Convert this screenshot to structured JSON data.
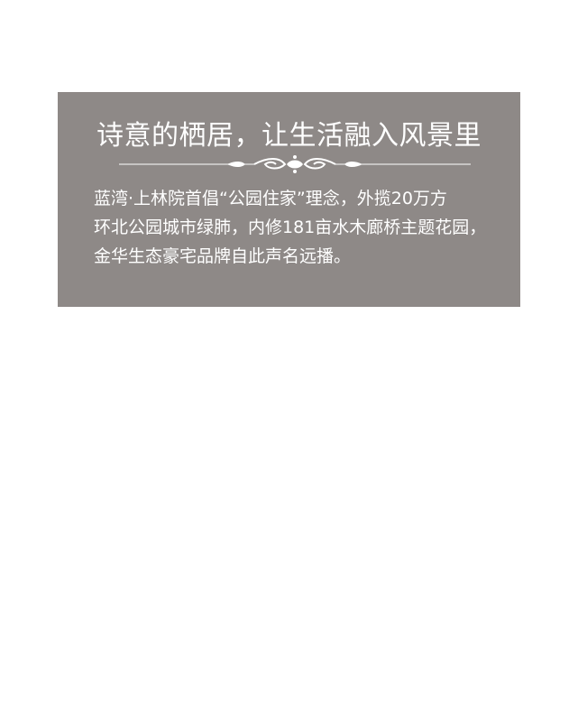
{
  "panel": {
    "title": "诗意的栖居，让生活融入风景里",
    "ornament_icon": "flourish-divider-icon",
    "body_lines": [
      "蓝湾·上林院首倡“公园住家”理念，外揽20万方",
      "环北公园城市绿肺，内修181亩水木廊桥主题花园，",
      "金华生态豪宅品牌自此声名远播。"
    ],
    "colors": {
      "panel_background": "#8e8987",
      "text": "#ffffff"
    }
  }
}
